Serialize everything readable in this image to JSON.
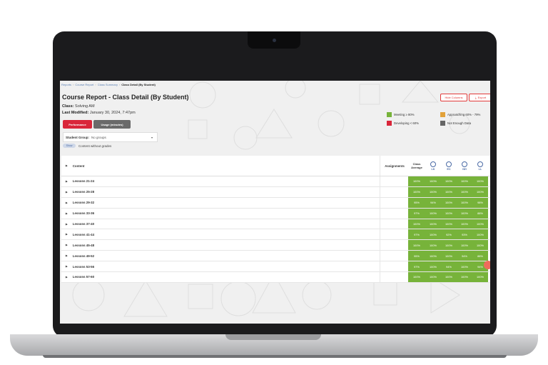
{
  "breadcrumb": {
    "items": [
      "Reports",
      "Course Report",
      "Class Summary"
    ],
    "current": "Class Detail (By Student)"
  },
  "page": {
    "title": "Course Report - Class Detail (By Student)",
    "class_label": "Class:",
    "class_value": "Solving AM",
    "modified_label": "Last Modified:",
    "modified_value": "January 30, 2024, 7:47pm"
  },
  "buttons": {
    "hide_columns": "Hide Columns",
    "export": "Export"
  },
  "tabs": {
    "performance": "Performance",
    "usage": "Usage (minutes)"
  },
  "legend": {
    "meeting": "Meeting ≥ 80%",
    "approaching": "Approaching 60% - 79%",
    "developing": "Developing < 60%",
    "not_enough": "Not Enough Data",
    "colors": {
      "meeting": "#77b33a",
      "approaching": "#e2a23a",
      "developing": "#d9263a",
      "not_enough": "#666666"
    }
  },
  "filter": {
    "label": "Student Group:",
    "value": "No groups"
  },
  "toggle": {
    "label": "Show",
    "text": "Content without grades"
  },
  "table": {
    "headers": {
      "content": "Content",
      "assignments": "Assignments",
      "class_avg_1": "Class",
      "class_avg_2": "Average"
    },
    "students": [
      "LK",
      "EC",
      "NH",
      "LL"
    ],
    "rows": [
      {
        "name": "Lessons 21-24",
        "avg": "100%",
        "scores": [
          "100%",
          "100%",
          "100%",
          "100%"
        ]
      },
      {
        "name": "Lessons 25-28",
        "avg": "100%",
        "scores": [
          "100%",
          "100%",
          "100%",
          "100%"
        ]
      },
      {
        "name": "Lessons 29-32",
        "avg": "95%",
        "scores": [
          "94%",
          "100%",
          "100%",
          "98%"
        ]
      },
      {
        "name": "Lessons 33-36",
        "avg": "97%",
        "scores": [
          "100%",
          "100%",
          "100%",
          "88%"
        ]
      },
      {
        "name": "Lessons 37-40",
        "avg": "100%",
        "scores": [
          "100%",
          "100%",
          "100%",
          "100%"
        ]
      },
      {
        "name": "Lessons 41-44",
        "avg": "97%",
        "scores": [
          "100%",
          "92%",
          "93%",
          "100%"
        ]
      },
      {
        "name": "Lessons 45-48",
        "avg": "100%",
        "scores": [
          "100%",
          "100%",
          "100%",
          "100%"
        ]
      },
      {
        "name": "Lessons 49-52",
        "avg": "95%",
        "scores": [
          "100%",
          "100%",
          "94%",
          "88%"
        ]
      },
      {
        "name": "Lessons 53-56",
        "avg": "97%",
        "scores": [
          "100%",
          "94%",
          "100%",
          "94%"
        ]
      },
      {
        "name": "Lessons 57-60",
        "avg": "100%",
        "scores": [
          "100%",
          "100%",
          "100%",
          "100%"
        ]
      }
    ]
  }
}
